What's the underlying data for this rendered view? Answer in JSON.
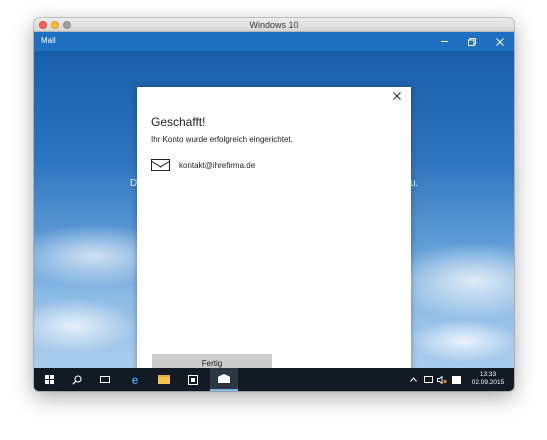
{
  "mac_window": {
    "title": "Windows 10"
  },
  "app": {
    "title": "Mail"
  },
  "background_text": {
    "left": "D",
    "right": "u."
  },
  "dialog": {
    "title": "Geschafft!",
    "subtitle": "Ihr Konto wurde erfolgreich eingerichtet.",
    "account_email": "kontakt@ihrefirma.de",
    "done_label": "Fertig"
  },
  "taskbar": {
    "clock_time": "13:33",
    "clock_date": "02.09.2015"
  },
  "colors": {
    "title_bar": "#1f6fc3",
    "taskbar": "#121a24",
    "button": "#cccccc"
  }
}
